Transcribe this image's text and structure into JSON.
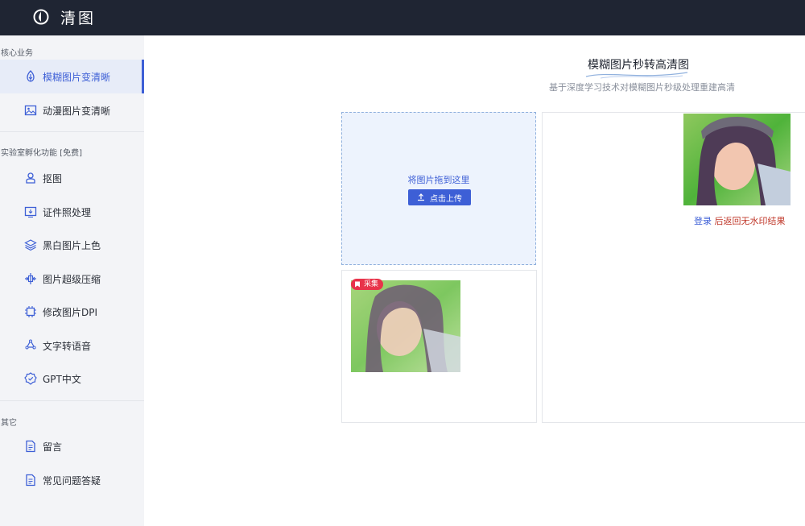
{
  "app": {
    "title": "清图"
  },
  "sidebar": {
    "sections": [
      {
        "title": "核心业务"
      },
      {
        "title": "实验室孵化功能 [免费]"
      },
      {
        "title": "其它"
      }
    ],
    "items": [
      {
        "label": "模糊图片变清晰",
        "icon": "ai-enhance-icon",
        "active": true
      },
      {
        "label": "动漫图片变清晰",
        "icon": "image-icon"
      },
      {
        "label": "抠图",
        "icon": "person-cutout-icon"
      },
      {
        "label": "证件照处理",
        "icon": "id-photo-icon"
      },
      {
        "label": "黑白图片上色",
        "icon": "layers-icon"
      },
      {
        "label": "图片超级压缩",
        "icon": "compress-icon"
      },
      {
        "label": "修改图片DPI",
        "icon": "chip-icon"
      },
      {
        "label": "文字转语音",
        "icon": "recycle-icon"
      },
      {
        "label": "GPT中文",
        "icon": "gear-badge-icon"
      },
      {
        "label": "留言",
        "icon": "document-icon"
      },
      {
        "label": "常见问题答疑",
        "icon": "document-icon"
      }
    ]
  },
  "main": {
    "title": "模糊图片秒转高清图",
    "subtitle": "基于深度学习技术对模糊图片秒级处理重建高清",
    "upload": {
      "drop_text": "将图片拖到这里",
      "button_label": "点击上传",
      "icon": "upload-icon"
    },
    "original": {
      "badge": "采集"
    },
    "result": {
      "login_link": "登录",
      "note": " 后返回无水印结果"
    }
  },
  "colors": {
    "topbar": "#1f2533",
    "accent": "#3d5fd6",
    "sidebar_bg": "#f3f4f7",
    "drop_bg": "#edf3fd",
    "badge": "#e8334a",
    "note_red": "#c0392b"
  }
}
